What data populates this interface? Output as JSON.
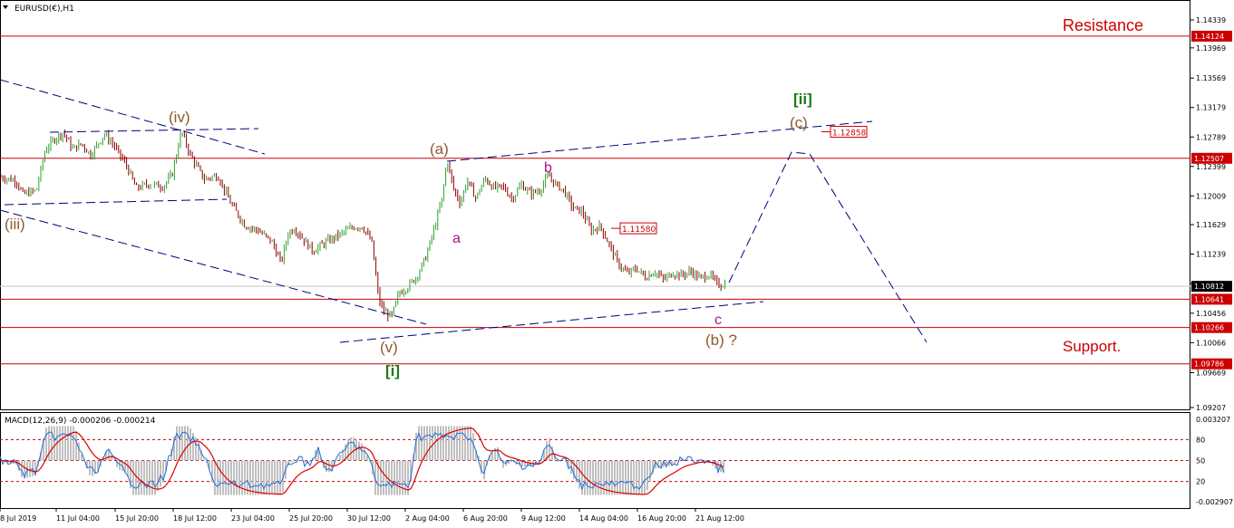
{
  "symbol_header": "EURUSD(€),H1",
  "macd_header": "MACD(12,26,9) -0.000206 -0.000214",
  "colors": {
    "resistance_line": "#cc0000",
    "bull_candle": "#2ca02c",
    "bear_candle": "#8b0000",
    "trendline": "#000080",
    "wave_brown": "#8b5a2b",
    "wave_magenta": "#aa1488",
    "wave_green": "#1a7a1a",
    "macd_hist": "#c0c0c0",
    "macd_signal": "#dd0000",
    "macd_overlay": "#1e6fd9"
  },
  "chart_data": [
    {
      "type": "candlestick",
      "title": "EURUSD(€),H1",
      "ylim": [
        1.09207,
        1.14339
      ],
      "y_ticks": [
        "1.14339",
        "1.13969",
        "1.13569",
        "1.13179",
        "1.12789",
        "1.12399",
        "1.12009",
        "1.11629",
        "1.11239",
        "1.10849",
        "1.10456",
        "1.10066",
        "1.09669",
        "1.09207"
      ],
      "x_ticks": [
        "8 Jul 2019",
        "11 Jul 04:00",
        "15 Jul 20:00",
        "18 Jul 12:00",
        "23 Jul 04:00",
        "25 Jul 20:00",
        "30 Jul 12:00",
        "2 Aug 04:00",
        "6 Aug 20:00",
        "9 Aug 12:00",
        "14 Aug 04:00",
        "16 Aug 20:00",
        "21 Aug 12:00"
      ],
      "price_path": [
        [
          0,
          1.1226
        ],
        [
          18,
          1.1221
        ],
        [
          25,
          1.1203
        ],
        [
          40,
          1.1208
        ],
        [
          50,
          1.1262
        ],
        [
          60,
          1.1276
        ],
        [
          70,
          1.1285
        ],
        [
          80,
          1.1263
        ],
        [
          90,
          1.127
        ],
        [
          100,
          1.1255
        ],
        [
          115,
          1.1283
        ],
        [
          125,
          1.1269
        ],
        [
          140,
          1.124
        ],
        [
          150,
          1.1211
        ],
        [
          165,
          1.1217
        ],
        [
          180,
          1.1213
        ],
        [
          190,
          1.123
        ],
        [
          200,
          1.1287
        ],
        [
          210,
          1.1255
        ],
        [
          225,
          1.1223
        ],
        [
          240,
          1.1228
        ],
        [
          255,
          1.119
        ],
        [
          270,
          1.1162
        ],
        [
          285,
          1.1155
        ],
        [
          300,
          1.114
        ],
        [
          310,
          1.1112
        ],
        [
          318,
          1.1152
        ],
        [
          325,
          1.1158
        ],
        [
          335,
          1.1143
        ],
        [
          345,
          1.1128
        ],
        [
          360,
          1.114
        ],
        [
          375,
          1.115
        ],
        [
          390,
          1.116
        ],
        [
          400,
          1.116
        ],
        [
          410,
          1.114
        ],
        [
          418,
          1.1062
        ],
        [
          424,
          1.1047
        ],
        [
          432,
          1.1041
        ],
        [
          440,
          1.1072
        ],
        [
          450,
          1.1081
        ],
        [
          460,
          1.1095
        ],
        [
          470,
          1.1121
        ],
        [
          480,
          1.1162
        ],
        [
          488,
          1.12
        ],
        [
          493,
          1.125
        ],
        [
          500,
          1.1211
        ],
        [
          508,
          1.1191
        ],
        [
          515,
          1.1222
        ],
        [
          525,
          1.1198
        ],
        [
          535,
          1.1224
        ],
        [
          545,
          1.1211
        ],
        [
          555,
          1.1213
        ],
        [
          565,
          1.1197
        ],
        [
          575,
          1.1216
        ],
        [
          585,
          1.1204
        ],
        [
          595,
          1.1208
        ],
        [
          605,
          1.1228
        ],
        [
          612,
          1.1217
        ],
        [
          622,
          1.1208
        ],
        [
          632,
          1.1185
        ],
        [
          642,
          1.118
        ],
        [
          652,
          1.1155
        ],
        [
          662,
          1.1161
        ],
        [
          672,
          1.1136
        ],
        [
          682,
          1.1111
        ],
        [
          692,
          1.1098
        ],
        [
          702,
          1.1105
        ],
        [
          712,
          1.1093
        ],
        [
          722,
          1.1101
        ],
        [
          732,
          1.109
        ],
        [
          742,
          1.1099
        ],
        [
          752,
          1.1096
        ],
        [
          762,
          1.1101
        ],
        [
          772,
          1.1092
        ],
        [
          782,
          1.1097
        ],
        [
          792,
          1.1083
        ],
        [
          800,
          1.1084
        ]
      ],
      "price_labels": [
        {
          "text": "1.14124",
          "value": 1.14124,
          "style": "axis"
        },
        {
          "text": "1.12507",
          "value": 1.12507,
          "style": "axis"
        },
        {
          "text": "1.10812",
          "value": 1.10812,
          "style": "current"
        },
        {
          "text": "1.10641",
          "value": 1.10641,
          "style": "axis"
        },
        {
          "text": "1.10266",
          "value": 1.10266,
          "style": "axis"
        },
        {
          "text": "1.09786",
          "value": 1.09786,
          "style": "axis"
        },
        {
          "text": "1.12858",
          "value": 1.12858,
          "style": "inline"
        },
        {
          "text": "1.11580",
          "value": 1.1158,
          "style": "inline"
        }
      ],
      "horizontal_levels": [
        1.14124,
        1.12507,
        1.10641,
        1.10266,
        1.09786
      ],
      "current_price": 1.10812,
      "annotations": {
        "resistance": "Resistance",
        "support": "Support.",
        "iii": "(iii)",
        "iv": "(iv)",
        "v": "(v)",
        "i_bracket": "[i]",
        "a_paren": "(a)",
        "a_small": "a",
        "b_small": "b",
        "c_small": "c",
        "b_paren": "(b) ?",
        "c_paren": "(c)",
        "ii_bracket": "[ii]"
      }
    },
    {
      "type": "macd",
      "title": "MACD(12,26,9) -0.000206 -0.000214",
      "y_ticks": [
        "0.003207",
        "80",
        "50",
        "20",
        "-0.002907"
      ],
      "levels": [
        80,
        50,
        20
      ],
      "range": [
        0,
        100
      ]
    }
  ]
}
